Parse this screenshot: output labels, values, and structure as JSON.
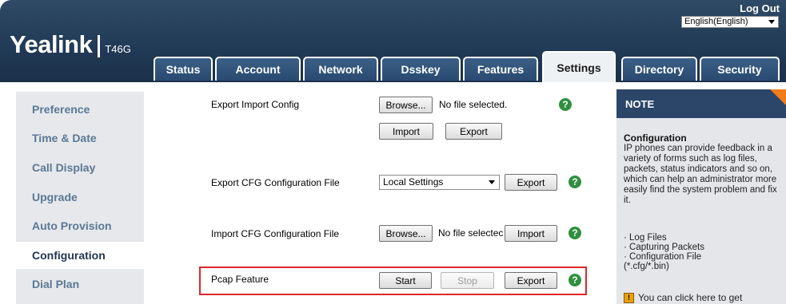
{
  "header": {
    "logo": "Yealink",
    "model": "T46G",
    "logout": "Log Out",
    "language": "English(English)"
  },
  "tabs": [
    {
      "label": "Status"
    },
    {
      "label": "Account"
    },
    {
      "label": "Network"
    },
    {
      "label": "Dsskey"
    },
    {
      "label": "Features"
    },
    {
      "label": "Settings",
      "active": true
    },
    {
      "label": "Directory"
    },
    {
      "label": "Security"
    }
  ],
  "sidebar": {
    "items": [
      {
        "label": "Preference"
      },
      {
        "label": "Time & Date"
      },
      {
        "label": "Call Display"
      },
      {
        "label": "Upgrade"
      },
      {
        "label": "Auto Provision"
      },
      {
        "label": "Configuration",
        "active": true
      },
      {
        "label": "Dial Plan"
      }
    ]
  },
  "content": {
    "export_import_config": {
      "label": "Export Import Config",
      "browse": "Browse...",
      "file_status": "No file selected.",
      "import": "Import",
      "export": "Export"
    },
    "export_cfg": {
      "label": "Export CFG Configuration File",
      "select_value": "Local Settings",
      "export": "Export"
    },
    "import_cfg": {
      "label": "Import CFG Configuration File",
      "browse": "Browse...",
      "file_status": "No file selectec",
      "import": "Import"
    },
    "pcap": {
      "label": "Pcap Feature",
      "start": "Start",
      "stop": "Stop",
      "export": "Export"
    },
    "help_glyph": "?"
  },
  "note": {
    "heading": "NOTE",
    "title": "Configuration",
    "body": "IP phones can provide feedback in a variety of forms such as log files, packets, status indicators and so on, which can help an administrator more easily find the system problem and fix it.",
    "bullets": [
      "· Log Files",
      "· Capturing Packets",
      "· Configuration File",
      "(*.cfg/*.bin)"
    ],
    "tip": "You can click here to get"
  },
  "colors": {
    "header_bg": "#213a55",
    "accent_orange": "#f07d1a",
    "help_green": "#2f8f3f",
    "highlight_red": "#e0262a"
  }
}
